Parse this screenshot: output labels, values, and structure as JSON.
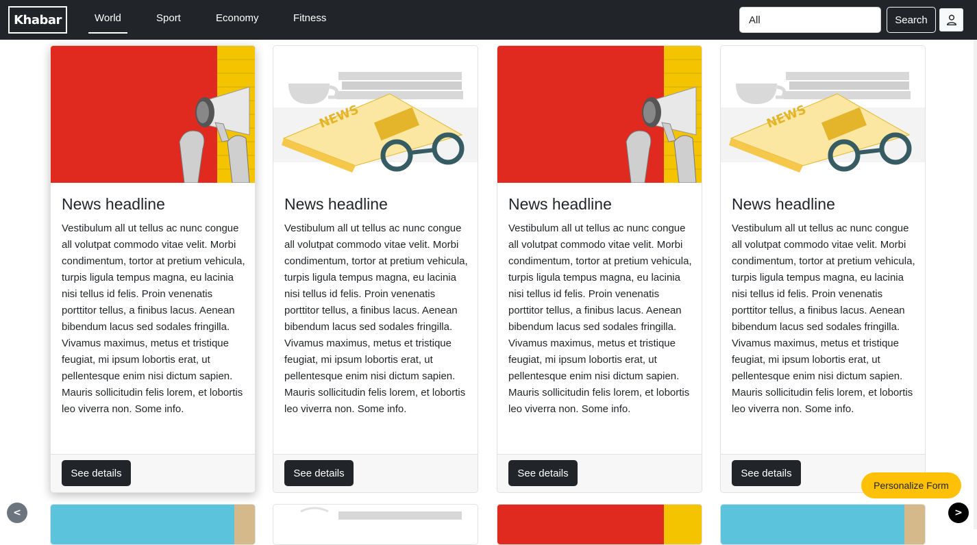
{
  "navbar": {
    "brand": "Khabar",
    "links": [
      {
        "label": "World",
        "active": true
      },
      {
        "label": "Sport"
      },
      {
        "label": "Economy"
      },
      {
        "label": "Fitness"
      }
    ],
    "search_value": "All",
    "search_button": "Search",
    "user_icon": "person-icon"
  },
  "cards": [
    {
      "image": "megaphone-image",
      "title": "News headline",
      "text": "Vestibulum all ut tellus ac nunc congue all volutpat commodo vitae velit. Morbi condimentum, tortor at pretium vehicula, turpis ligula tempus magna, eu lacinia nisi tellus id felis. Proin venenatis porttitor tellus, a finibus lacus. Aenean bibendum lacus sed sodales fringilla. Vivamus maximus, metus et tristique feugiat, mi ipsum lobortis erat, ut pellentesque enim nisi dictum sapien. Mauris sollicitudin felis lorem, et lobortis leo viverra non. Some info.",
      "button": "See details"
    },
    {
      "image": "newspaper-image",
      "title": "News headline",
      "text": "Vestibulum all ut tellus ac nunc congue all volutpat commodo vitae velit. Morbi condimentum, tortor at pretium vehicula, turpis ligula tempus magna, eu lacinia nisi tellus id felis. Proin venenatis porttitor tellus, a finibus lacus. Aenean bibendum lacus sed sodales fringilla. Vivamus maximus, metus et tristique feugiat, mi ipsum lobortis erat, ut pellentesque enim nisi dictum sapien. Mauris sollicitudin felis lorem, et lobortis leo viverra non. Some info.",
      "button": "See details"
    },
    {
      "image": "megaphone-image",
      "title": "News headline",
      "text": "Vestibulum all ut tellus ac nunc congue all volutpat commodo vitae velit. Morbi condimentum, tortor at pretium vehicula, turpis ligula tempus magna, eu lacinia nisi tellus id felis. Proin venenatis porttitor tellus, a finibus lacus. Aenean bibendum lacus sed sodales fringilla. Vivamus maximus, metus et tristique feugiat, mi ipsum lobortis erat, ut pellentesque enim nisi dictum sapien. Mauris sollicitudin felis lorem, et lobortis leo viverra non. Some info.",
      "button": "See details"
    },
    {
      "image": "newspaper-image",
      "title": "News headline",
      "text": "Vestibulum all ut tellus ac nunc congue all volutpat commodo vitae velit. Morbi condimentum, tortor at pretium vehicula, turpis ligula tempus magna, eu lacinia nisi tellus id felis. Proin venenatis porttitor tellus, a finibus lacus. Aenean bibendum lacus sed sodales fringilla. Vivamus maximus, metus et tristique feugiat, mi ipsum lobortis erat, ut pellentesque enim nisi dictum sapien. Mauris sollicitudin felis lorem, et lobortis leo viverra non. Some info.",
      "button": "See details"
    }
  ],
  "floating": {
    "personalize": "Personalize Form",
    "prev": "<",
    "next": ">"
  },
  "colors": {
    "navbar": "#212529",
    "accent_yellow": "#ffc107",
    "megaphone_red": "#e02a1f",
    "megaphone_yellow": "#f5c400"
  }
}
